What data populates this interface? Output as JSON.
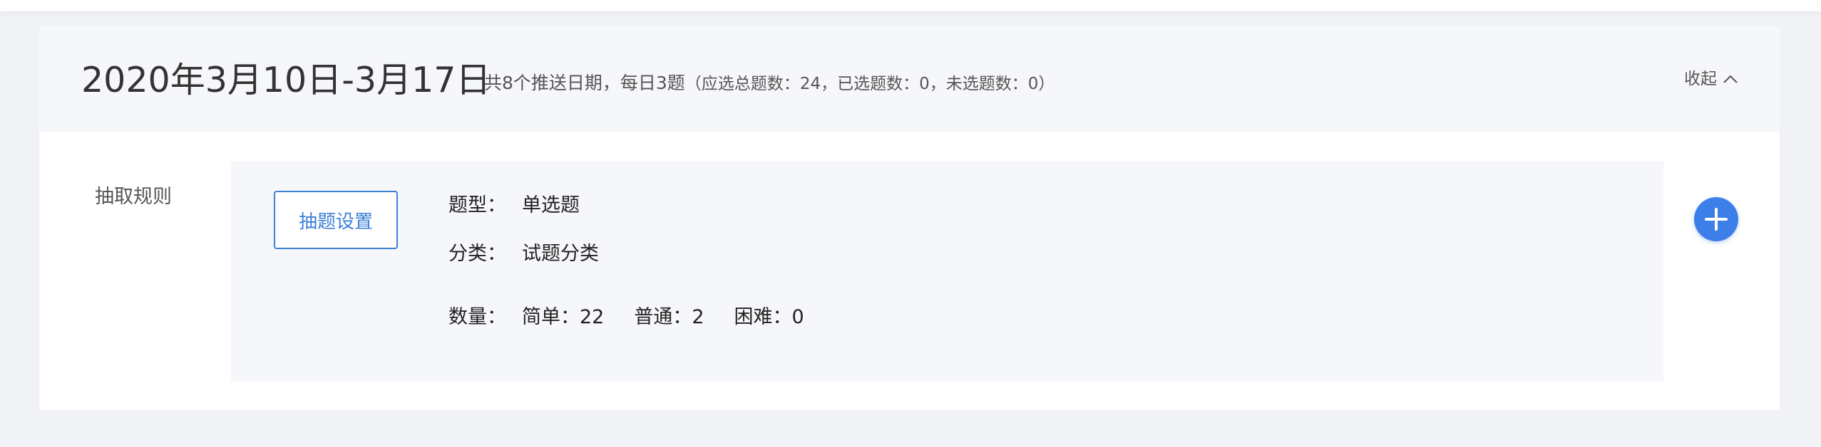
{
  "header": {
    "date_range": "2020年3月10日-3月17日",
    "summary_main": "共8个推送日期，每日3题",
    "summary_detail": "（应选总题数：24，已选题数：0，未选题数：0）",
    "collapse_label": "收起",
    "collapse_icon": "chevron-up-icon"
  },
  "rule": {
    "label": "抽取规则",
    "config_button_label": "抽题设置",
    "type_label": "题型：",
    "type_value": "单选题",
    "category_label": "分类：",
    "category_value": "试题分类",
    "count_label": "数量：",
    "counts": [
      {
        "text": "简单：22"
      },
      {
        "text": "普通：2"
      },
      {
        "text": "困难：0"
      }
    ]
  },
  "add_button": {
    "icon": "plus-icon",
    "color": "#3d7fe8"
  },
  "colors": {
    "accent": "#3d7fd9",
    "header_bg": "#f6f7fa",
    "page_bg": "#f0f2f5"
  }
}
